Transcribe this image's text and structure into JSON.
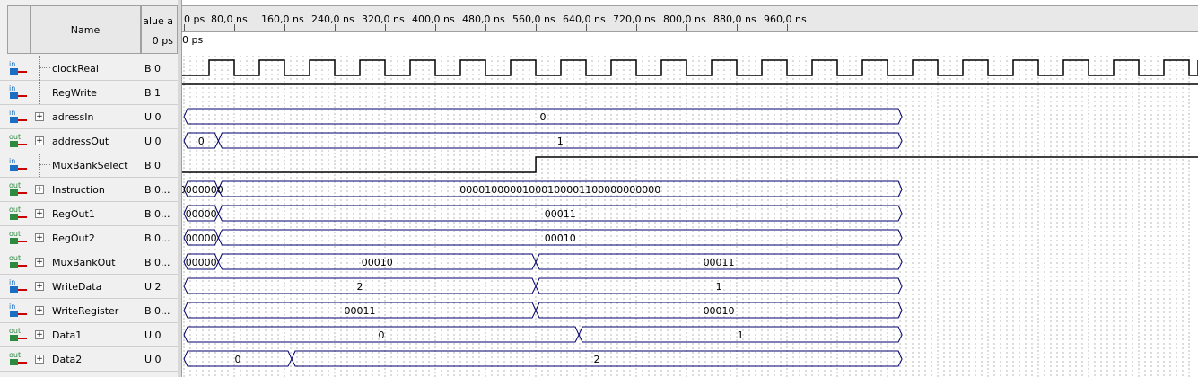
{
  "header": {
    "name_col": "Name",
    "value_col_line1": "alue a",
    "value_col_line2": "0 ps"
  },
  "timeline": {
    "ticks": [
      "0 ps",
      "80,0 ns",
      "160,0 ns",
      "240,0 ns",
      "320,0 ns",
      "400,0 ns",
      "480,0 ns",
      "560,0 ns",
      "640,0 ns",
      "720,0 ns",
      "800,0 ns",
      "880,0 ns",
      "960,0 ns"
    ],
    "cursor_label": "0 ps"
  },
  "colors": {
    "in_icon": "#1a6fc4",
    "out_icon": "#2b8a3e",
    "wave": "#00006b",
    "grid": "#b8b8b8"
  },
  "signals": [
    {
      "name": "clockReal",
      "value": "B 0",
      "dir": "in",
      "expandable": false,
      "kind": "clock"
    },
    {
      "name": "RegWrite",
      "value": "B 1",
      "dir": "in",
      "expandable": false,
      "kind": "high"
    },
    {
      "name": "adressIn",
      "value": "U 0",
      "dir": "in",
      "expandable": true,
      "kind": "bus",
      "segments": [
        {
          "start": 0,
          "end": 1000,
          "label": "0"
        }
      ]
    },
    {
      "name": "addressOut",
      "value": "U 0",
      "dir": "out",
      "expandable": true,
      "kind": "bus",
      "segments": [
        {
          "start": 0,
          "end": 48,
          "label": "0"
        },
        {
          "start": 48,
          "end": 1000,
          "label": "1"
        }
      ]
    },
    {
      "name": "MuxBankSelect",
      "value": "B 0",
      "dir": "in",
      "expandable": false,
      "kind": "step",
      "low_until": 490
    },
    {
      "name": "Instruction",
      "value": "B 0...",
      "dir": "out",
      "expandable": true,
      "kind": "bus",
      "segments": [
        {
          "start": 0,
          "end": 48,
          "label": "0000000"
        },
        {
          "start": 48,
          "end": 1000,
          "label": "00001000001000100001100000000000"
        }
      ]
    },
    {
      "name": "RegOut1",
      "value": "B 0...",
      "dir": "out",
      "expandable": true,
      "kind": "bus",
      "segments": [
        {
          "start": 0,
          "end": 48,
          "label": "00000"
        },
        {
          "start": 48,
          "end": 1000,
          "label": "00011"
        }
      ]
    },
    {
      "name": "RegOut2",
      "value": "B 0...",
      "dir": "out",
      "expandable": true,
      "kind": "bus",
      "segments": [
        {
          "start": 0,
          "end": 48,
          "label": "00000"
        },
        {
          "start": 48,
          "end": 1000,
          "label": "00010"
        }
      ]
    },
    {
      "name": "MuxBankOut",
      "value": "B 0...",
      "dir": "out",
      "expandable": true,
      "kind": "bus",
      "segments": [
        {
          "start": 0,
          "end": 48,
          "label": "00000"
        },
        {
          "start": 48,
          "end": 490,
          "label": "00010"
        },
        {
          "start": 490,
          "end": 1000,
          "label": "00011"
        }
      ]
    },
    {
      "name": "WriteData",
      "value": "U 2",
      "dir": "in",
      "expandable": true,
      "kind": "bus",
      "segments": [
        {
          "start": 0,
          "end": 490,
          "label": "2"
        },
        {
          "start": 490,
          "end": 1000,
          "label": "1"
        }
      ]
    },
    {
      "name": "WriteRegister",
      "value": "B 0...",
      "dir": "in",
      "expandable": true,
      "kind": "bus",
      "segments": [
        {
          "start": 0,
          "end": 490,
          "label": "00011"
        },
        {
          "start": 490,
          "end": 1000,
          "label": "00010"
        }
      ]
    },
    {
      "name": "Data1",
      "value": "U 0",
      "dir": "out",
      "expandable": true,
      "kind": "bus",
      "segments": [
        {
          "start": 0,
          "end": 550,
          "label": "0"
        },
        {
          "start": 550,
          "end": 1000,
          "label": "1"
        }
      ]
    },
    {
      "name": "Data2",
      "value": "U 0",
      "dir": "out",
      "expandable": true,
      "kind": "bus",
      "segments": [
        {
          "start": 0,
          "end": 150,
          "label": "0"
        },
        {
          "start": 150,
          "end": 1000,
          "label": "2"
        }
      ]
    }
  ]
}
